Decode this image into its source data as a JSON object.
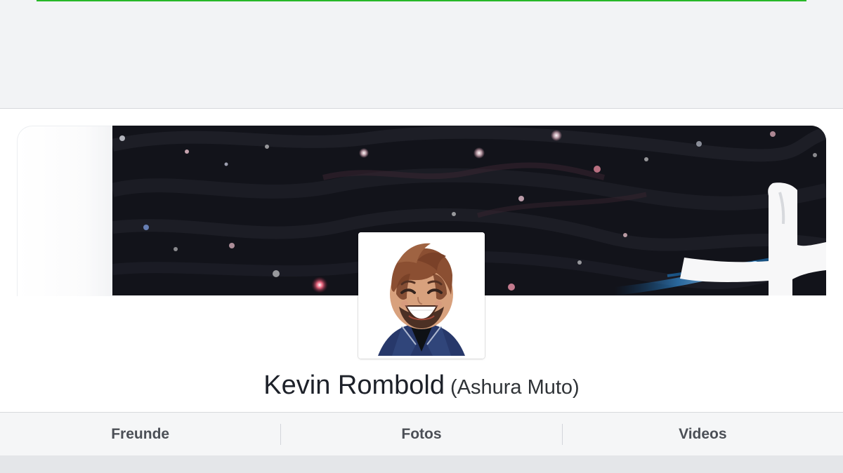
{
  "profile": {
    "name": "Kevin Rombold",
    "alternate_name": "(Ashura Muto)"
  },
  "tabs": [
    {
      "label": "Freunde"
    },
    {
      "label": "Fotos"
    },
    {
      "label": "Videos"
    }
  ],
  "colors": {
    "accent_progress": "#28b828",
    "tab_text": "#4b4f56",
    "page_background": "#f2f3f5"
  },
  "images": {
    "cover": "space-cover-photo",
    "avatar": "smiling-bitmoji-avatar"
  }
}
